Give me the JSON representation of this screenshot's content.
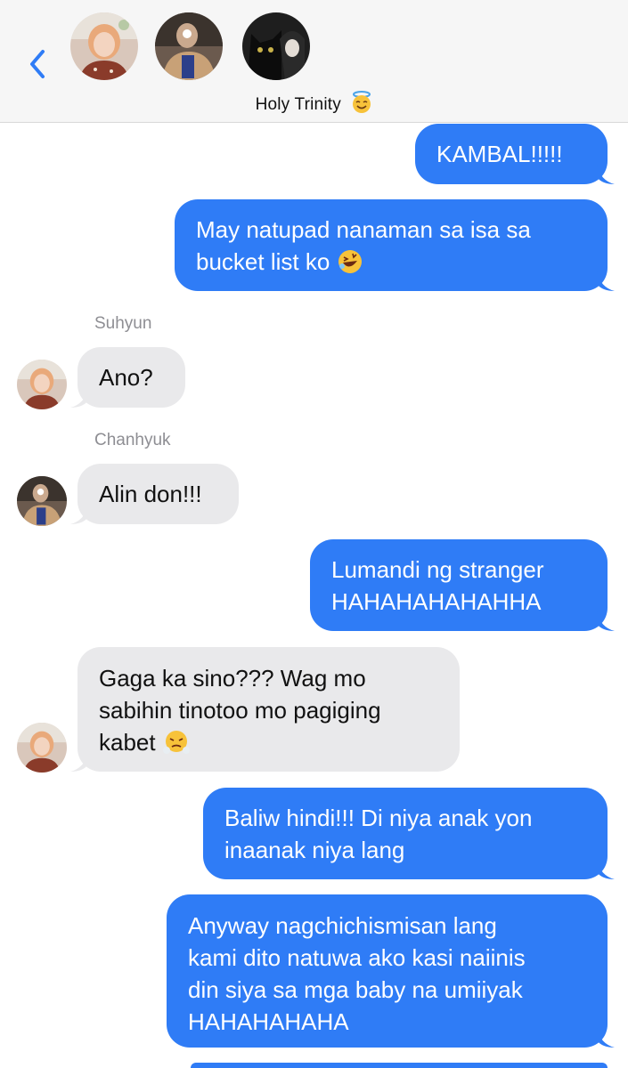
{
  "header": {
    "back_icon": "chevron-left-icon",
    "group_name": "Holy Trinity",
    "group_emoji_icon": "smiling-face-with-halo-icon",
    "avatars": [
      "avatar-suhyun",
      "avatar-chanhyuk",
      "avatar-black-cat"
    ]
  },
  "colors": {
    "outgoing_bubble": "#2f7cf6",
    "incoming_bubble": "#e9e9eb",
    "header_bg": "#f6f6f6",
    "accent": "#2f7cf6"
  },
  "messages": [
    {
      "direction": "out",
      "lines": [
        "KAMBAL!!!!!"
      ]
    },
    {
      "direction": "out",
      "lines": [
        "May natupad nanaman sa isa sa",
        "bucket list ko"
      ],
      "emoji": "rolling-on-floor-laughing-icon"
    },
    {
      "direction": "in",
      "sender": "Suhyun",
      "lines": [
        "Ano?"
      ]
    },
    {
      "direction": "in",
      "sender": "Chanhyuk",
      "lines": [
        "Alin don!!!"
      ]
    },
    {
      "direction": "out",
      "lines": [
        "Lumandi ng stranger",
        "HAHAHAHAHAHHA"
      ]
    },
    {
      "direction": "in",
      "lines": [
        "Gaga ka sino??? Wag mo",
        "sabihin tinotoo mo pagiging",
        "kabet"
      ],
      "emoji": "face-with-steam-from-nose-icon"
    },
    {
      "direction": "out",
      "lines": [
        "Baliw hindi!!! Di niya anak yon",
        "inaanak niya lang"
      ]
    },
    {
      "direction": "out",
      "lines": [
        "Anyway nagchichismisan lang",
        "kami dito natuwa ako kasi naiinis",
        "din siya sa mga baby na umiiyak",
        "HAHAHAHAHA"
      ]
    }
  ]
}
